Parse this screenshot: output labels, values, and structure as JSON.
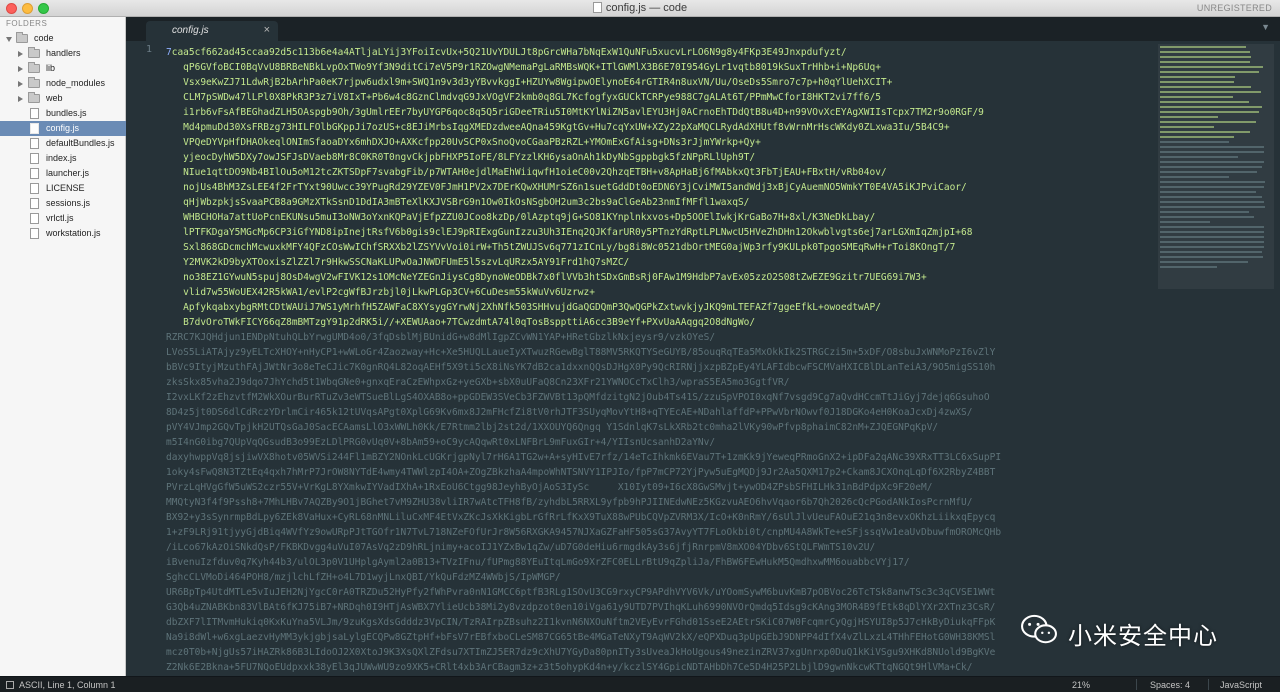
{
  "window": {
    "title": "config.js — code",
    "registration": "UNREGISTERED"
  },
  "sidebar": {
    "header": "FOLDERS",
    "items": [
      {
        "label": "code",
        "type": "folder",
        "expanded": true,
        "depth": 0
      },
      {
        "label": "handlers",
        "type": "folder",
        "expanded": false,
        "depth": 1
      },
      {
        "label": "lib",
        "type": "folder",
        "expanded": false,
        "depth": 1
      },
      {
        "label": "node_modules",
        "type": "folder",
        "expanded": false,
        "depth": 1
      },
      {
        "label": "web",
        "type": "folder",
        "expanded": false,
        "depth": 1
      },
      {
        "label": "bundles.js",
        "type": "file",
        "depth": 1
      },
      {
        "label": "config.js",
        "type": "file",
        "depth": 1,
        "selected": true
      },
      {
        "label": "defaultBundles.js",
        "type": "file",
        "depth": 1
      },
      {
        "label": "index.js",
        "type": "file",
        "depth": 1
      },
      {
        "label": "launcher.js",
        "type": "file",
        "depth": 1
      },
      {
        "label": "LICENSE",
        "type": "file",
        "depth": 1
      },
      {
        "label": "sessions.js",
        "type": "file",
        "depth": 1
      },
      {
        "label": "vrlctl.js",
        "type": "file",
        "depth": 1
      },
      {
        "label": "workstation.js",
        "type": "file",
        "depth": 1
      }
    ]
  },
  "tabs": [
    {
      "label": "config.js",
      "active": true,
      "close": "×"
    }
  ],
  "tab_dropdown": "▼",
  "editor": {
    "line_number": "1",
    "lines": [
      "7caa5cf662ad45ccaa92d5c113b6e4a4ATljaLYij3YFoiIcvUx+5Q21UvYDULJt8pGrcWHa7bNqExW1QuNFu5xucvLrLO6N9g8y4FKp3E49Jnxpdufyzt/",
      "   qP6GVfoBCI0BqVvU8BRBeNBkLvpOxTWo9Yf3N9ditCi7eV5P9r1RZOwgNMemaPgLaRMBsWQK+ITlGWMlX3B6E70I954GyLr1vqtb8019kSuxTrHhb+i+Np6Uq+",
      "   Vsx9eKwZJ71LdwRjB2bArhPa0eK7rjpw6udxl9m+SWQ1n9v3d3yYBvvkggI+HZUYw8WgipwOElynoE64rGTIR4n8uxVN/Uu/OseDs5Smro7c7p+h0qYlUehXCIT+",
      "   CLM7pSWDw47lLPl0X8PkR3P3z7iV8IxT+Pb6w4c8GznClmdvqG9JxVOgVF2kmb0q8GL7KcfogfyxGUCkTCRPye988C7gALAt6T/PPmMwCforI8HKT2vi7ff6/5",
      "   i1rb6vFsAfBEGhadZLH5OAspgb9Oh/3gUmlrEEr7byUYGP6qoc8q5Q5riGDeeTRiu5I0MtKYlNiZN5avlEYU3Hj0ACrnoEhTDdQtB8u4D+n99VOvXcEYAgXWIIsTcpx7TM2r9o0RGF/9",
      "   Md4pmuDd30XsFRBzg73HILFOlbGKppJi7ozUS+c8EJiMrbsIqgXMEDzdweeAQna459KgtGv+Hu7cqYxUW+XZy22pXaMQCLRydAdXHUtf8vWrnMrHscWKdy0ZLxwa3Iu/5B4C9+",
      "   VPQeDYVpHfDHAOkeqlONImSfaoaDYx6mhDXJO+AXKcfpp20UvSCP0xSnoQvoCGaaPBzRZL+YMOmExGfAisg+DNs3rJjmYWrkp+Qy+",
      "   yjeocDyhW5DXy7owJSFJsDVaeb8Mr8C0KR0T0ngvCkjpbFHXP5IoFE/8LFYzzlKH6ysaOnAh1kDyNbSgppbgk5fzNPpRLlUph9T/",
      "   NIue1qttDO9Nb4BIlOu5oM12tcZKTSDpF7svabgFib/p7WTAH0ejdlMaEhWiiqwfH1oieC00v2QhzqETBH+v8ApHaBj6fMAbkxQt3FbTjEAU+FBxtH/vRb04ov/",
      "   nojUs4BhM3ZsLEE4f2FrTYxt90Uwcc39YPugRd29YZEV0FJmH1PV2x7DErKQwXHUMrSZ6n1suetGddDt0oEDN6Y3jCviMWI5andWdj3xBjCyAuemNO5WmkYT0E4VA5iKJPviCaor/",
      "   qHjWbzpkjsSvaaPCB8a9GMzXTkSsnD1DdIA3mBTeXlKXJVSBrG9n1Ow0IkOsNSgbOH2um3c2bs9aClGeAb23nmIfMFfl1waxqS/",
      "   WHBCHOHa7attUoPcnEKUNsu5muI3oNW3oYxnKQPaVjEfpZZU0JCoo8kzDp/0lAzptq9jG+SO81KYnplnkxvos+Dp5OOElIwkjKrGaBo7H+8xl/K3NeDkLbay/",
      "   lPTFKDgaY5MGcMp6CP3iGfYND8ipInejtRsfV6b0gis9clEJ9pRIExgGunIzzu3Uh3IEnq2QJKfarUR0y5PTnzYdRptLPLNwcU5HVeZhDHn12Okwblvgts6ej7arLGXmIqZmjpI+68",
      "   Sxl868GDcmchMcwuxkMFY4QFzCOsWwIChfSRXXb2lZSYVvVoi0irW+Th5tZWUJSv6q771zICnLy/bg8i8Wc0521dbOrtMEG0ajWp3rfy9KULpk0TpgoSMEqRwH+rToi8KOngT/7",
      "   Y2MVK2kD9byXTOoxisZlZZl7r9HkwSSCNaKLUPwOaJNWDFUmE5l5szvLqURzx5AY91Frd1hQ7sMZC/",
      "   no38EZ1GYwuN5spuj8OsD4wgV2wFIVK12s1OMcNeYZEGnJiysCg8DynoWeODBk7x0flVVb3htSDxGmBsRj0FAw1M9HdbP7avEx05zzO2S08tZwEZE9Gzitr7UEG69i7W3+",
      "   vlid7w55WoUEX42R5kWA1/evlP2cgWfBJrzbjl0jLkwPLGp3CV+6CuDesm55kWuVv6Uzrwz+",
      "   ApfykqabxybgRMtCDtWAUiJ7WS1yMrhfH5ZAWFaC8XYsygGYrwNj2XhNfk503SHHvujdGaQGDQmP3QwQGPkZxtwvkjyJKQ9mLTEFAZf7ggeEfkL+owoedtwAP/",
      "   B7dvOroTWkFICY66qZ8mBMTzgY91p2dRK5i//+XEWUAao+7TCwzdmtA74l0qTosBsppttiA6cc3B9eYf+PXvUaAAqgq2O8dNgWo/",
      "RZRC7KJQHdjun1ENDpNtuhQLbYrwgUMD4o0/3fqDsblMjBUnidG+w8dMlIgpZCvWN1YAP+HRetGbzlkNxjeysr9/vzkOYeS/",
      "LVoS5LiATAjyz9yELTcXHOY+nHyCP1+wWLoGr4Zaozway+Hc+Xe5HUQLLaueIyXTwuzRGewBglT88MV5RKQTYSeGUYB/85ouqRqTEa5MxOkkIk2STRGCzi5m+5xDF/O8sbuJxWNMoPzI6vZlY",
      "bBVc9ItyjMzuthFAjJWtNr3o8eTeCJic7K0gnRQ4L82oqAEHf5X9ti5cX8iNsYK7dB2ca1dxxnQQsDJHgX0Py9QcRIRNjjxzpBZpEy4YLAFIdbcwFSCMVaHXICBlDLanTeiA3/9O5migSS10h",
      "zksSkx85vha2J9dqo7JhYchd5t1WbqGNe0+gnxqEraCzEWhpxGz+yeGXb+sbX0uUFaQ8Cn23XFr21YWNOCcTxClh3/wpraS5EA5mo3GgtfVR/",
      "I2vxLKf2zEhzvtfM2WkXOurBurRTuZv3eWTSueBlLgS4OXAB8o+ppGDEW3SVeCb3FZWVBt13pQMfdzitgN2jOub4Ts41S/zzuSpVPOI0xqNf7vsgd9Cg7aQvdHCcmTtJiGyj7dejq6GsuhoO",
      "8D4z5jt0DS6dlCdRczYDrlmCir465k12tUVqsAPgt0XplG69Kv6mx8J2mFHcfZi8tV0rhJTF3SUyqMovYtH8+qTYEcAE+NDahlaffdP+PPwVbrNOwvf0J18DGKo4eH0KoaJcxDj4zwXS/",
      "pVY4VJmp2GQvTpjkH2UTQsGaJ0SacECAamsLlO3xWWLh0Kk/E7Rtmm2lbj2st2d/1XXOUYQ6Qngq Y1SdnlqK7sLkXRb2tc0mha2lVKy90wPfvp8phaimC82nM+ZJQEGNPqKpV/",
      "m5I4nG0ibg7QUpVqQGsudB3o99EzLDlPRG0vUq0V+8bAm59+oC9ycAQqwRt0xLNFBrL9mFuxGIr+4/YIIsnUcsanhD2aYNv/",
      "daxyhwppVq8jsjiwVX8hotv05WVSi244Fl1mBZY2NOnkLcUGKrjgpNyl7rH6A1TG2w+A+syHIvE7rfz/14eTcIhkmk6EVau7T+1zmKk9jYeweqPRmoGnX2+ipDFa2qANc39XRxTT3LC6xSupPI",
      "1oky4sFwQ8N3TZtEq4qxh7hMrP7JrOW8NYTdE4wmy4TWWlzpI4OA+ZOgZBkzhaA4mpoWhNTSNVY1IPJIo/fpP7mCP72YjPyw5uEgMQDj9Jr2Aa5QXM17p2+Ckam8JCXOnqLqDf6X2RbyZ4BBT",
      "PVrzLqHVgGfW5uWS2czr55V+VrKgL8YXmkwIYVadIXhA+1RxEoU6Ctgg98JeyhByOjAoS3IySc     X10Iyt09+I6cX8GwSMvjt+ywOD4ZPsbSFHILHk31nBdPdpXc9F20eM/",
      "MMQtyN3f4f9Pssh8+7MhLHBv7AQZBy9O1jBGhet7vM9ZHU38vliIR7wAtcTFH8fB/zyhdbL5RRXL9yfpb9hPJIINEdwNEz5KGzvuAEO6hvVqaor6b7Qh2026cQcPGodANkIosPcrnMfU/",
      "BX92+y3sSynrmpBdLpy6ZEk8VaHux+CyRL68nMNLiluCxMF4EtVxZKcJsXkKigbLrGfRrLfKxX9TuX88wPUbCQVpZVRM3X/IcO+K0nRmY/6sUlJlvUeuFAOuE21q3n8evxOKhzLiikxqEpycq",
      "1+zF9LRj91tjyyGjdBiq4WVfYz9owURpPJtTGOfr1N7TvL718NZeFOfUrJr8W56RXGKA9457NJXaGZFaHF505sG37AvyYT7FLoOkbi0t/cnpMU4A8WkTe+eSFjssqVw1eaUvDbuwfmOROMcQHb",
      "/iLco67kAzOiSNkdQsP/FKBKDvgg4uVuI07AsVq2zD9hRLjnimy+acoIJ1YZxBw1qZw/uD7G0deHiu6rmgdkAy3s6jfjRnrpmV8mXO04YDbv6StQLFWmTS10v2U/",
      "iBvenuIzfduv0q7Kyh44b3/ulOL3p0V1UHplgAyml2a0B13+TVzIFnu/fUPmg88YEuItqLmGo9XrZFC0ELLrBtU9qZpliJa/FhBW6FEwHukM5QmdhxwMM6ouabbcVYj17/",
      "SghcCLVMoDi464POH8/mzjlchLfZH+o4L7D1wyjLnxQBI/YkQuFdzMZ4WWbjS/IpWMGP/",
      "UR6BpTp4UtdMTLe5vIuJEH2NjYgcC0rA0TRZDu52HyPfy2fWhPvra0nN1GMCC6ptfB3RLg1SOvU3CG9rxyCP9APdhVYV6Vk/uYOomSywM6buvKmB7pOBVoc26TcTSk8anwTSc3c3qCVSE1WWt",
      "G3Qb4uZNABKbn83VlBAt6fKJ75iB7+NRDqh0I9HTjAsWBX7YlieUcb38Mi2y8vzdpzot0en10iVga61y9UTD7PVIhqKLuh6990NVOrQmdq5Idsg9cKAng3MOR4B9fEtk8qDlYXr2XTnz3CsR/",
      "dbZXF7lITMvmHukiq0KxKuYna5VLJm/9zuKgsXdsGdddz3VpCIN/TzRAIrpZBsuhz2I1kvnN6NXOuNftm2VEyEvrFGhd01SseE2AEtrSKiC07W0FcqmrCyQgjHSYUI8p5J7cHkByDiukqFFpK",
      "Na9i8dWl+w6xgLaezvHyMM3ykjgbjsaLylgECQPw8GZtpHf+bFsV7rEBfxboCLeSM87CG65tBe4MGaTeNXyT9AqWV2kX/eQPXDuq3pUpGEbJ9DNPP4dIfX4vZlLxzL4THhFEHotG0WH38KMSl",
      "mcz0T0b+NjgUs57iHAZRk86B3LIdoOJ2X0XtoJ9K3XsQXlZFdsu7XTImZJ5ER7dz9cXhU7YGyDa80pnITy3sUveaJkHoUgous49nezinZRV37xgUnrxp0DuQ1kKiVSgu9XHKd8NUold9BgKVe",
      "Z2Nk6E2Bkna+5FU7NQoEUdpxxk38yEl3qJUWwWU9zo9XK5+CRlt4xb3ArCBagm3z+z3t5ohypKd4n+y/kczlSY4GpicNDTAHbDh7Ce5D4H25P2LbjlD9gwnNkcwKTtqNGQt9HlVMa+Ck/",
      "tFVwr3kfgwY3QBbKihYngcDs/HsvzizecdPzOl/cjL6072cfJBgwdYTXfx9kFmZNzWB9MVGp4xt33bIPGwXy2dToHh72EpbjStbOk/lfMCHIM9kDMpTtiIwiiStgQivilz+cE1XKzR9KIf8",
      "anHIxhqcrR7ET3hkSaLpR75rd8rrCBJ+Mb5uQXQpJ3f9ZqZSMSpbwR2jczvCPXSX/2qOHwAT7JK0dOh5fWhOSsDa7Gg02o9xTRMaHE9Yqm1PGGvUIYaxuSH0b0",
      "P3TDIgTq+O8ZsYcVBk3ZCxiz+iaFeeiIoH7biseUaJULmUXV6XcxeLy0EnP/HwnTaMNL3yO4N2b/A=="
    ]
  },
  "watermark": {
    "text": "小米安全中心"
  },
  "statusbar": {
    "position": "ASCII, Line 1, Column 1",
    "zoom": "21%",
    "indentation": "Spaces: 4",
    "syntax": "JavaScript"
  },
  "colors": {
    "editor_bg": "#263238",
    "string": "#c3e88d",
    "number": "#8fb0ff",
    "comment_dim": "#5e7379",
    "selection": "#6a8bb5"
  }
}
